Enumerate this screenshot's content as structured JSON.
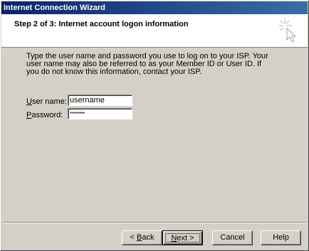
{
  "window": {
    "title": "Internet Connection Wizard"
  },
  "header": {
    "step_title": "Step 2 of 3: Internet account logon information",
    "icon": "wizard-cursor-icon"
  },
  "body": {
    "instructions": "Type the user name and password you use to log on to your ISP. Your user name may also be referred to as your Member ID or User ID. If you do not know this information, contact your ISP."
  },
  "form": {
    "username_label_accel": "U",
    "username_label_rest": "ser name:",
    "username_value": "username",
    "password_label_accel": "P",
    "password_label_rest": "assword:",
    "password_value": "********"
  },
  "buttons": {
    "back_accel": "B",
    "back_rest": "ack",
    "back_prefix": "< ",
    "next_accel": "N",
    "next_rest": "ext >",
    "cancel": "Cancel",
    "help": "Help"
  }
}
